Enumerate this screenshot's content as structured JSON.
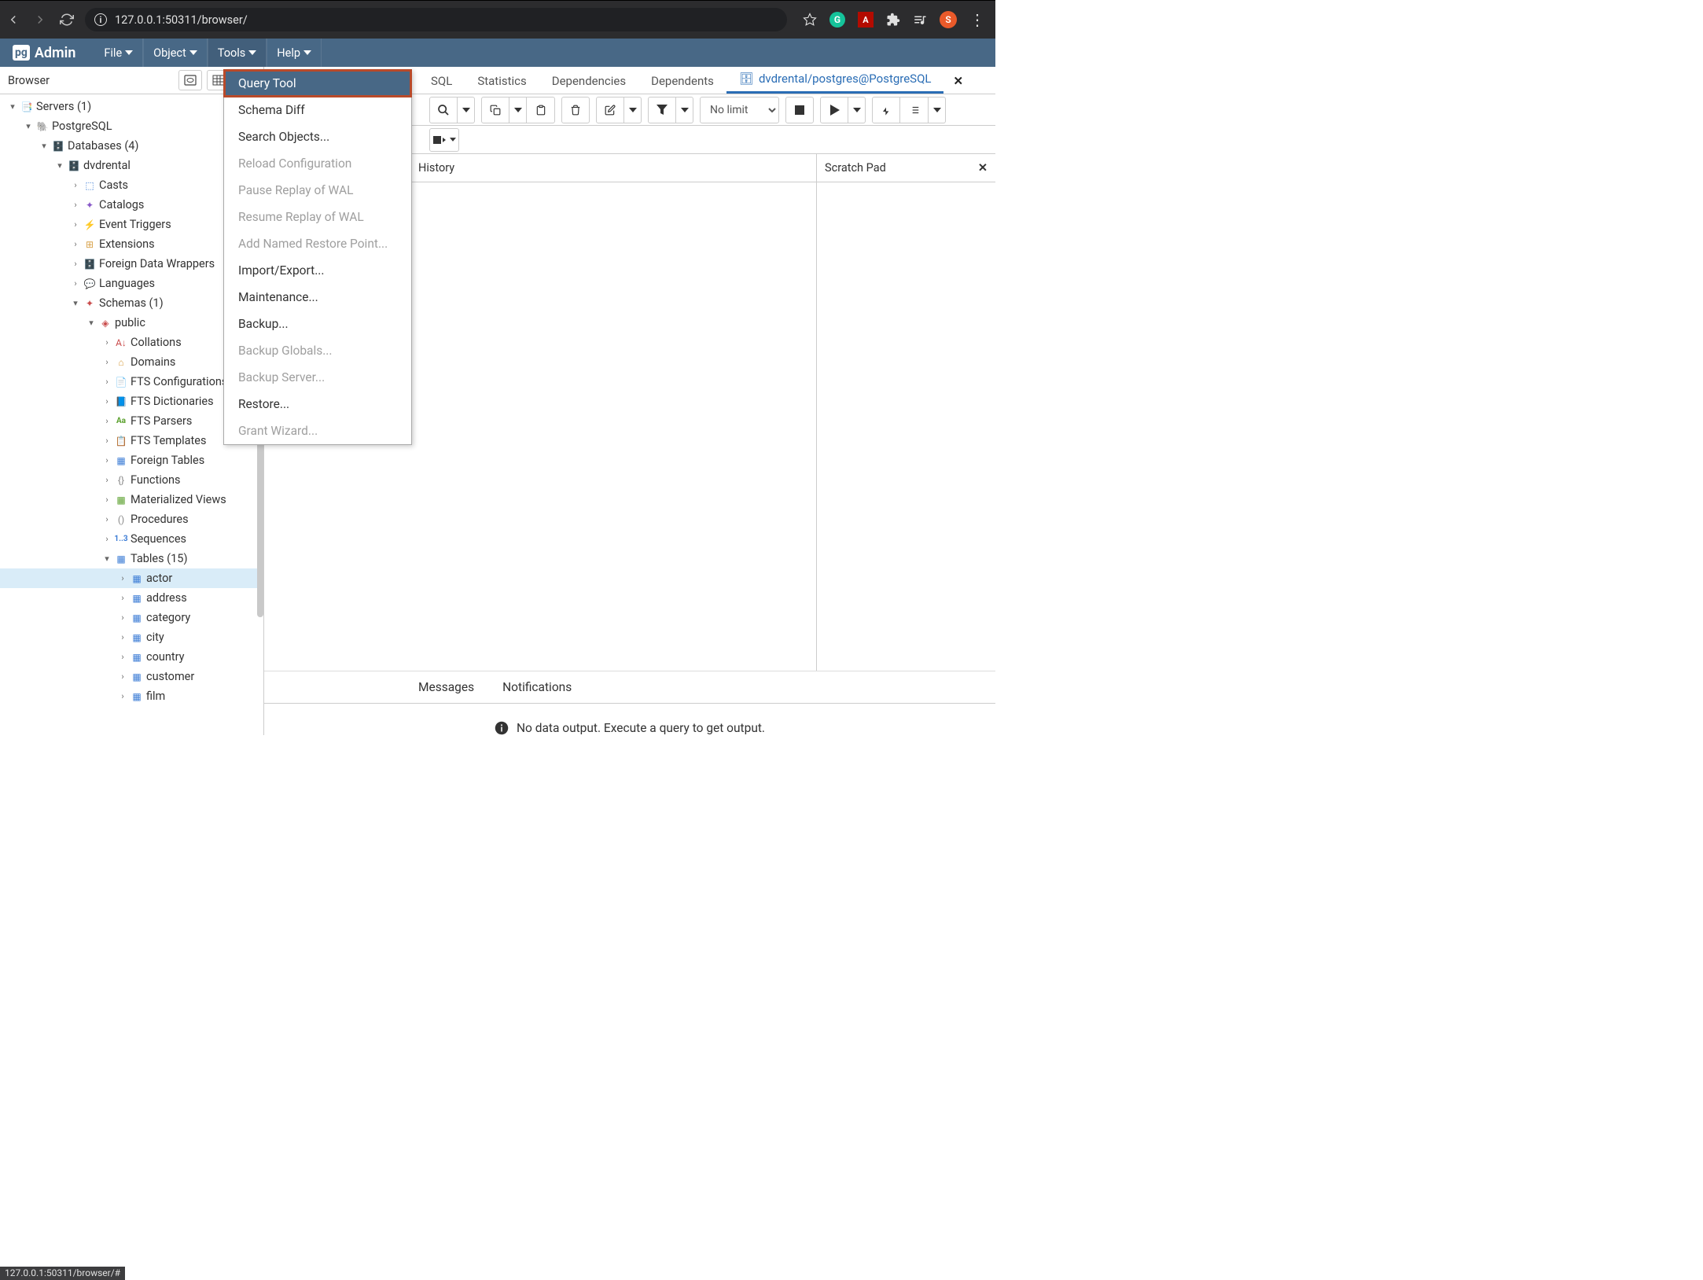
{
  "chrome": {
    "url": "127.0.0.1:50311/browser/",
    "avatar_letter": "S"
  },
  "menubar": {
    "logo": "pg",
    "brand": "Admin",
    "file": "File",
    "object": "Object",
    "tools": "Tools",
    "help": "Help"
  },
  "browser_panel": {
    "title": "Browser"
  },
  "tree": {
    "servers": "Servers (1)",
    "pg": "PostgreSQL",
    "dbs": "Databases (4)",
    "db1": "dvdrental",
    "casts": "Casts",
    "catalogs": "Catalogs",
    "event_trig": "Event Triggers",
    "ext": "Extensions",
    "fdw": "Foreign Data Wrappers",
    "lang": "Languages",
    "schemas": "Schemas (1)",
    "public": "public",
    "collations": "Collations",
    "domains": "Domains",
    "ftsconf": "FTS Configurations",
    "ftsdict": "FTS Dictionaries",
    "ftspars": "FTS Parsers",
    "ftstmpl": "FTS Templates",
    "foreign_tables": "Foreign Tables",
    "functions": "Functions",
    "matviews": "Materialized Views",
    "procs": "Procedures",
    "seq": "Sequences",
    "tables": "Tables (15)",
    "t_actor": "actor",
    "t_address": "address",
    "t_category": "category",
    "t_city": "city",
    "t_country": "country",
    "t_customer": "customer",
    "t_film": "film"
  },
  "tabs": {
    "sql": "SQL",
    "stats": "Statistics",
    "deps": "Dependencies",
    "depts": "Dependents",
    "active": "dvdrental/postgres@PostgreSQL"
  },
  "toolbar": {
    "nolimit": "No limit"
  },
  "history": "History",
  "scratch": "Scratch Pad",
  "out_tabs": {
    "messages": "Messages",
    "notifications": "Notifications"
  },
  "output_msg": "No data output. Execute a query to get output.",
  "dropdown": {
    "query_tool": "Query Tool",
    "schema_diff": "Schema Diff",
    "search_obj": "Search Objects...",
    "reload": "Reload Configuration",
    "pause": "Pause Replay of WAL",
    "resume": "Resume Replay of WAL",
    "restore_pt": "Add Named Restore Point...",
    "import": "Import/Export...",
    "maint": "Maintenance...",
    "backup": "Backup...",
    "backup_g": "Backup Globals...",
    "backup_s": "Backup Server...",
    "restore": "Restore...",
    "grant": "Grant Wizard..."
  },
  "status_bar": "127.0.0.1:50311/browser/#"
}
